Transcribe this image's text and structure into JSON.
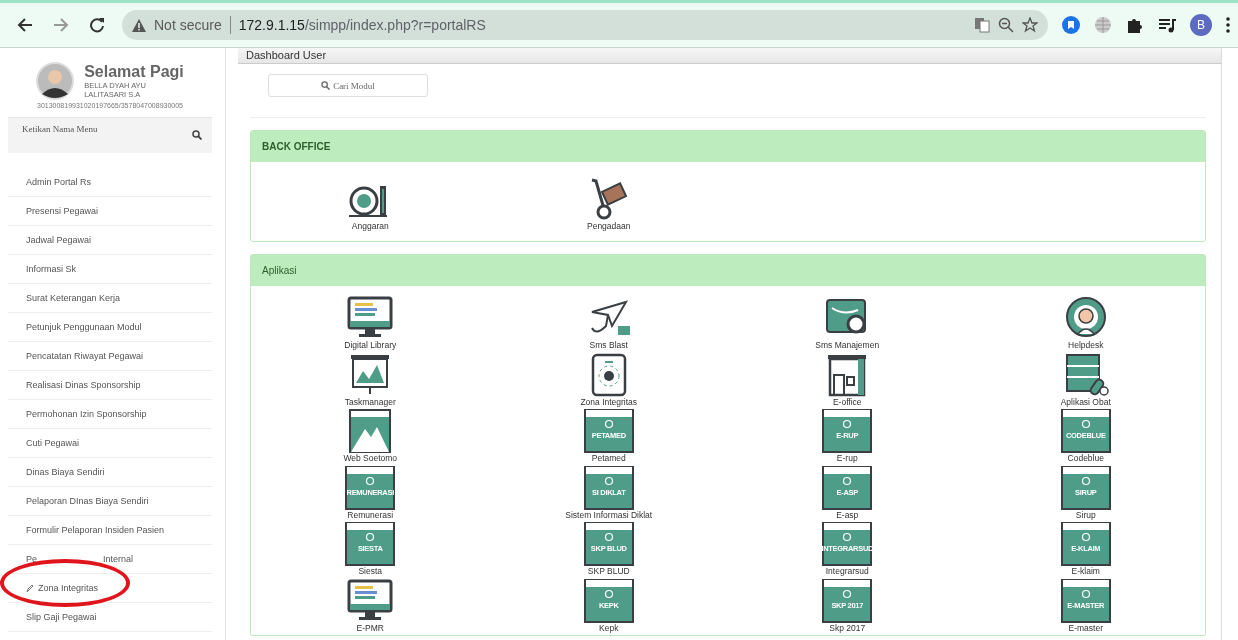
{
  "browser": {
    "security": "Not secure",
    "url_host": "172.9.1.15",
    "url_path": "/simpp/index.php?r=portalRS",
    "profile_initial": "B"
  },
  "profile": {
    "greeting": "Selamat Pagi",
    "name": "BELLA DYAH AYU LALITASARI S.A",
    "id": "301300819931020197665/3578047008930005"
  },
  "menu_search": {
    "placeholder": "Ketikan Nama Menu"
  },
  "menu": [
    {
      "label": "Admin Portal Rs",
      "kind": "plain"
    },
    {
      "label": "Presensi Pegawai",
      "kind": "plain"
    },
    {
      "label": "Jadwal Pegawai",
      "kind": "plain"
    },
    {
      "label": "Informasi Sk",
      "kind": "plain"
    },
    {
      "label": "Surat Keterangan Kerja",
      "kind": "plain"
    },
    {
      "label": "Petunjuk Penggunaan Modul",
      "kind": "plain"
    },
    {
      "label": "Pencatatan Riwayat Pegawai",
      "kind": "plain"
    },
    {
      "label": "Realisasi Dinas Sponsorship",
      "kind": "plain"
    },
    {
      "label": "Permohonan Izin Sponsorship",
      "kind": "plain"
    },
    {
      "label": "Cuti Pegawai",
      "kind": "plain"
    },
    {
      "label": "Dinas Biaya Sendiri",
      "kind": "plain"
    },
    {
      "label": "Pelaporan DInas Biaya Sendiri",
      "kind": "plain"
    },
    {
      "label": "Formulir Pelaporan Insiden Pasien",
      "kind": "plain"
    },
    {
      "label": "Pe",
      "label_end": "Internal",
      "kind": "covered"
    },
    {
      "label": "Zona Integritas",
      "kind": "pencil"
    },
    {
      "label": "Slip Gaji Pegawai",
      "kind": "plain"
    }
  ],
  "page_title": "Dashboard User",
  "module_search": {
    "label": "Cari Modul"
  },
  "sections": [
    {
      "title": "BACK OFFICE",
      "modules": [
        {
          "label": "Anggaran",
          "kind": "budget"
        },
        {
          "label": "Pengadaan",
          "kind": "trolley"
        }
      ]
    },
    {
      "title": "Aplikasi",
      "modules": [
        {
          "label": "Digital Library",
          "kind": "monitor"
        },
        {
          "label": "Sms Blast",
          "kind": "plane"
        },
        {
          "label": "Sms Manajemen",
          "kind": "gearcard"
        },
        {
          "label": "Helpdesk",
          "kind": "headset"
        },
        {
          "label": "Taskmanager",
          "kind": "easel"
        },
        {
          "label": "Zona Integritas",
          "kind": "tablet"
        },
        {
          "label": "E-office",
          "kind": "shop"
        },
        {
          "label": "Aplikasi Obat",
          "kind": "server"
        },
        {
          "label": "Web Soetomo",
          "kind": "mountain"
        },
        {
          "label": "Petamed",
          "kind": "tile",
          "tile_text": "PETAMED"
        },
        {
          "label": "E-rup",
          "kind": "tile",
          "tile_text": "E-RUP"
        },
        {
          "label": "Codeblue",
          "kind": "tile",
          "tile_text": "CODEBLUE"
        },
        {
          "label": "Remunerasi",
          "kind": "tile",
          "tile_text": "REMUNERASI"
        },
        {
          "label": "Sistem Informasi Diklat",
          "kind": "tile",
          "tile_text": "SI DIKLAT"
        },
        {
          "label": "E-asp",
          "kind": "tile",
          "tile_text": "E-ASP"
        },
        {
          "label": "Sirup",
          "kind": "tile",
          "tile_text": "SIRUP"
        },
        {
          "label": "Siesta",
          "kind": "tile",
          "tile_text": "SIESTA"
        },
        {
          "label": "SKP BLUD",
          "kind": "tile",
          "tile_text": "SKP BLUD"
        },
        {
          "label": "Integrarsud",
          "kind": "tile",
          "tile_text": "INTEGRARSUD"
        },
        {
          "label": "E-klaim",
          "kind": "tile",
          "tile_text": "E-KLAIM"
        },
        {
          "label": "E-PMR",
          "kind": "monitor"
        },
        {
          "label": "Kepk",
          "kind": "tile",
          "tile_text": "KEPK"
        },
        {
          "label": "Skp 2017",
          "kind": "tile",
          "tile_text": "SKP 2017"
        },
        {
          "label": "E-master",
          "kind": "tile",
          "tile_text": "E-MASTER"
        }
      ]
    }
  ]
}
